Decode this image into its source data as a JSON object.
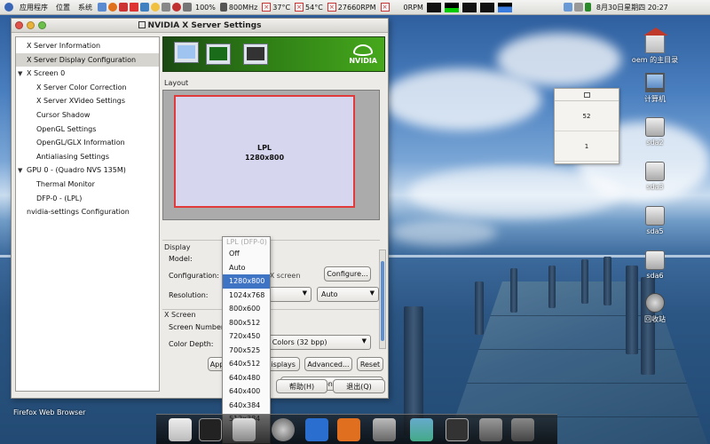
{
  "top_panel": {
    "menu_apps": "应用程序",
    "menu_places": "位置",
    "menu_system": "系统",
    "cpu_percent": "100%",
    "cpu_freq": "800MHz",
    "temp1": "37°C",
    "temp2": "54°C",
    "fan1": "27660RPM",
    "fan2": "0RPM",
    "datetime": "8月30日星期四 20:27"
  },
  "window": {
    "title": "NVIDIA X Server Settings",
    "tree": [
      {
        "label": "X Server Information",
        "indent": 0,
        "expander": false,
        "selected": false
      },
      {
        "label": "X Server Display Configuration",
        "indent": 0,
        "expander": false,
        "selected": true
      },
      {
        "label": "X Screen 0",
        "indent": 0,
        "expander": true,
        "selected": false
      },
      {
        "label": "X Server Color Correction",
        "indent": 1,
        "expander": false,
        "selected": false
      },
      {
        "label": "X Server XVideo Settings",
        "indent": 1,
        "expander": false,
        "selected": false
      },
      {
        "label": "Cursor Shadow",
        "indent": 1,
        "expander": false,
        "selected": false
      },
      {
        "label": "OpenGL Settings",
        "indent": 1,
        "expander": false,
        "selected": false
      },
      {
        "label": "OpenGL/GLX Information",
        "indent": 1,
        "expander": false,
        "selected": false
      },
      {
        "label": "Antialiasing Settings",
        "indent": 1,
        "expander": false,
        "selected": false
      },
      {
        "label": "GPU 0 - (Quadro NVS 135M)",
        "indent": 0,
        "expander": true,
        "selected": false
      },
      {
        "label": "Thermal Monitor",
        "indent": 1,
        "expander": false,
        "selected": false
      },
      {
        "label": "DFP-0 - (LPL)",
        "indent": 1,
        "expander": false,
        "selected": false
      },
      {
        "label": "nvidia-settings Configuration",
        "indent": 0,
        "expander": false,
        "selected": false
      }
    ],
    "banner_logo": "NVIDIA",
    "layout_label": "Layout",
    "display_name": "LPL",
    "display_res": "1280x800",
    "display_section": "Display",
    "model_label": "Model:",
    "model_value": "LPL (DFP-0)",
    "configuration_label": "Configuration:",
    "configuration_value": "Separate X screen",
    "configure_button": "Configure...",
    "resolution_label": "Resolution:",
    "refresh_value": "Auto",
    "xscreen_section": "X Screen",
    "screen_number_label": "Screen Number:",
    "color_depth_label": "Color Depth:",
    "color_depth_value": "Millions of Colors (32 bpp)",
    "apply_button": "Apply",
    "detect_button": "Detect Displays",
    "advanced_button": "Advanced...",
    "reset_button": "Reset",
    "save_button": "Save to X Configuration File",
    "help_button": "帮助(H)",
    "quit_button": "退出(Q)"
  },
  "resolution_dropdown": {
    "header": "LPL (DFP-0)",
    "options": [
      "Off",
      "Auto",
      "1280x800",
      "1024x768",
      "800x600",
      "800x512",
      "720x450",
      "700x525",
      "640x512",
      "640x480",
      "640x400",
      "640x384",
      "512x384"
    ],
    "selected": "1280x800"
  },
  "mini_panel": {
    "value1": "52",
    "value2": "1"
  },
  "desktop_icons": [
    {
      "label": "oem 的主目录",
      "icon": "home-folder-icon"
    },
    {
      "label": "计算机",
      "icon": "computer-icon"
    },
    {
      "label": "sda2",
      "icon": "drive-icon"
    },
    {
      "label": "sda3",
      "icon": "drive-icon"
    },
    {
      "label": "sda5",
      "icon": "drive-icon"
    },
    {
      "label": "sda6",
      "icon": "drive-icon"
    },
    {
      "label": "回收站",
      "icon": "trash-icon"
    }
  ],
  "firefox_label": "Firefox Web Browser",
  "colors": {
    "selection": "#3f73c4",
    "nvidia_green": "#46a81c",
    "display_border": "#e03a3a"
  }
}
